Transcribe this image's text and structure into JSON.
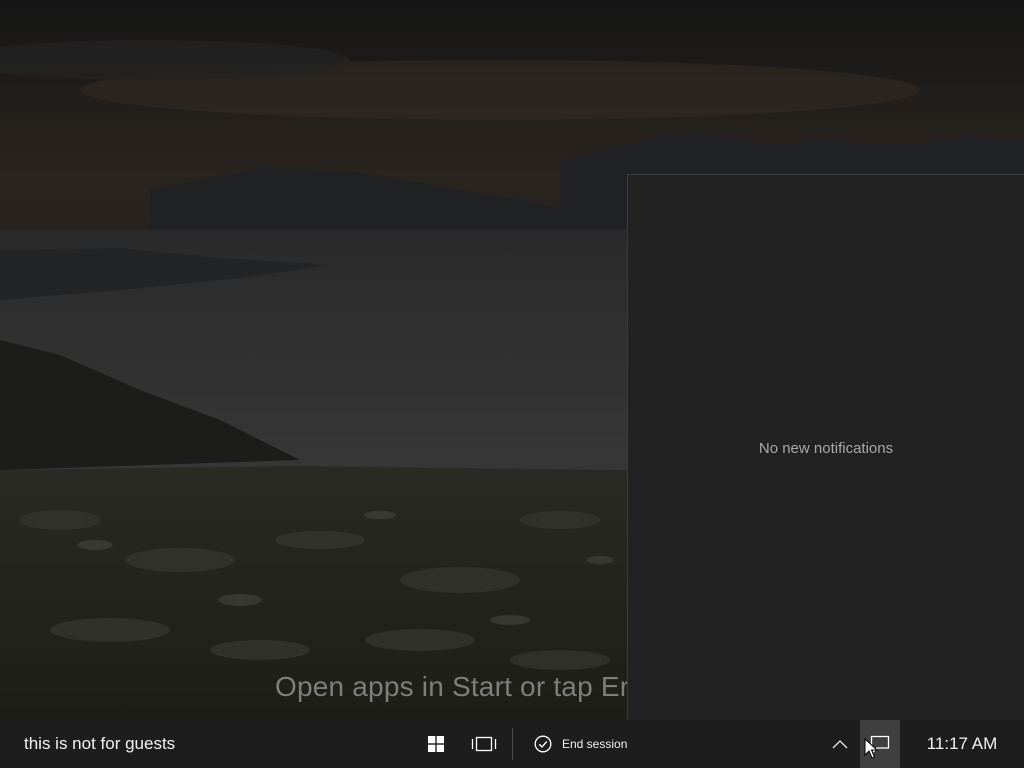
{
  "desktop": {
    "wallpaper": "mountain-landscape-wallpaper",
    "hint": "Open apps in Start or tap Er"
  },
  "action_center": {
    "empty_message": "No new notifications"
  },
  "taskbar": {
    "label": "this is not for guests",
    "start_icon": "windows-logo-icon",
    "taskview_icon": "task-view-icon",
    "end_session": {
      "icon": "check-circle-icon",
      "label": "End session"
    },
    "overflow_icon": "chevron-up-icon",
    "notifications_icon": "action-center-icon",
    "clock": "11:17 AM"
  },
  "colors": {
    "taskbar_bg": "#1d1d1d",
    "action_center_bg": "#222222",
    "notif_button_active": "#3f3f3f"
  }
}
